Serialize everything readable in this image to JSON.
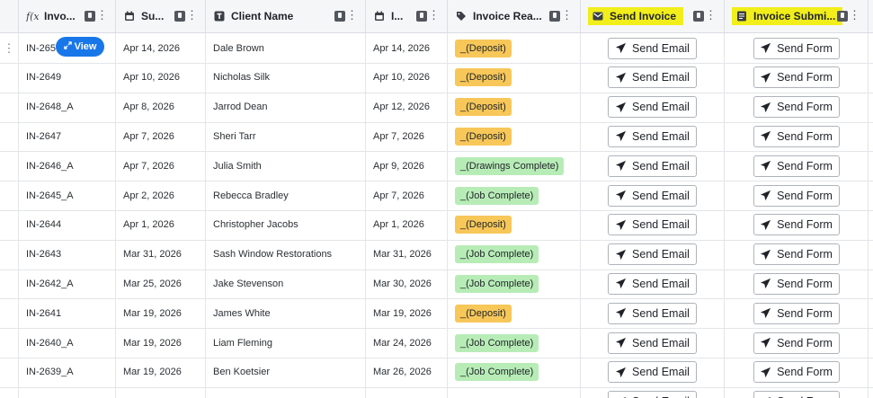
{
  "columns": [
    {
      "label": "Invo...",
      "icon": "formula-icon"
    },
    {
      "label": "Su...",
      "icon": "calendar-icon"
    },
    {
      "label": "Client Name",
      "icon": "text-icon"
    },
    {
      "label": "I...",
      "icon": "calendar-icon"
    },
    {
      "label": "Invoice Rea...",
      "icon": "tag-icon"
    },
    {
      "label": "Send Invoice",
      "icon": "email-icon"
    },
    {
      "label": "Invoice Submi...",
      "icon": "form-icon"
    }
  ],
  "view_label": "View",
  "rows": [
    {
      "id": "IN-265",
      "submitted": "Apr 14, 2026",
      "client": "Dale Brown",
      "invoice_date": "Apr 14, 2026",
      "reason": "_(Deposit)",
      "reason_color": "orange",
      "email": "Send Email",
      "form": "Send Form"
    },
    {
      "id": "IN-2649",
      "submitted": "Apr 10, 2026",
      "client": "Nicholas Silk",
      "invoice_date": "Apr 10, 2026",
      "reason": "_(Deposit)",
      "reason_color": "orange",
      "email": "Send Email",
      "form": "Send Form"
    },
    {
      "id": "IN-2648_A",
      "submitted": "Apr 8, 2026",
      "client": "Jarrod Dean",
      "invoice_date": "Apr 12, 2026",
      "reason": "_(Deposit)",
      "reason_color": "orange",
      "email": "Send Email",
      "form": "Send Form"
    },
    {
      "id": "IN-2647",
      "submitted": "Apr 7, 2026",
      "client": "Sheri Tarr",
      "invoice_date": "Apr 7, 2026",
      "reason": "_(Deposit)",
      "reason_color": "orange",
      "email": "Send Email",
      "form": "Send Form"
    },
    {
      "id": "IN-2646_A",
      "submitted": "Apr 7, 2026",
      "client": "Julia Smith",
      "invoice_date": "Apr 9, 2026",
      "reason": "_(Drawings Complete)",
      "reason_color": "green",
      "email": "Send Email",
      "form": "Send Form"
    },
    {
      "id": "IN-2645_A",
      "submitted": "Apr 2, 2026",
      "client": "Rebecca Bradley",
      "invoice_date": "Apr 7, 2026",
      "reason": "_(Job Complete)",
      "reason_color": "green",
      "email": "Send Email",
      "form": "Send Form"
    },
    {
      "id": "IN-2644",
      "submitted": "Apr 1, 2026",
      "client": "Christopher Jacobs",
      "invoice_date": "Apr 1, 2026",
      "reason": "_(Deposit)",
      "reason_color": "orange",
      "email": "Send Email",
      "form": "Send Form"
    },
    {
      "id": "IN-2643",
      "submitted": "Mar 31, 2026",
      "client": "Sash Window Restorations",
      "invoice_date": "Mar 31, 2026",
      "reason": "_(Job Complete)",
      "reason_color": "green",
      "email": "Send Email",
      "form": "Send Form"
    },
    {
      "id": "IN-2642_A",
      "submitted": "Mar 25, 2026",
      "client": "Jake Stevenson",
      "invoice_date": "Mar 30, 2026",
      "reason": "_(Job Complete)",
      "reason_color": "green",
      "email": "Send Email",
      "form": "Send Form"
    },
    {
      "id": "IN-2641",
      "submitted": "Mar 19, 2026",
      "client": "James White",
      "invoice_date": "Mar 19, 2026",
      "reason": "_(Deposit)",
      "reason_color": "orange",
      "email": "Send Email",
      "form": "Send Form"
    },
    {
      "id": "IN-2640_A",
      "submitted": "Mar 19, 2026",
      "client": "Liam Fleming",
      "invoice_date": "Mar 24, 2026",
      "reason": "_(Job Complete)",
      "reason_color": "green",
      "email": "Send Email",
      "form": "Send Form"
    },
    {
      "id": "IN-2639_A",
      "submitted": "Mar 19, 2026",
      "client": "Ben Koetsier",
      "invoice_date": "Mar 26, 2026",
      "reason": "_(Job Complete)",
      "reason_color": "green",
      "email": "Send Email",
      "form": "Send Form"
    },
    {
      "id": "",
      "submitted": "",
      "client": "",
      "invoice_date": "",
      "reason": "",
      "reason_color": "green",
      "email": "Send Email",
      "form": "Send Form"
    }
  ],
  "colors": {
    "highlight": "#f1ee1b",
    "orange": "#f7c759",
    "green": "#b8ecb7",
    "accent": "#1877e8"
  }
}
